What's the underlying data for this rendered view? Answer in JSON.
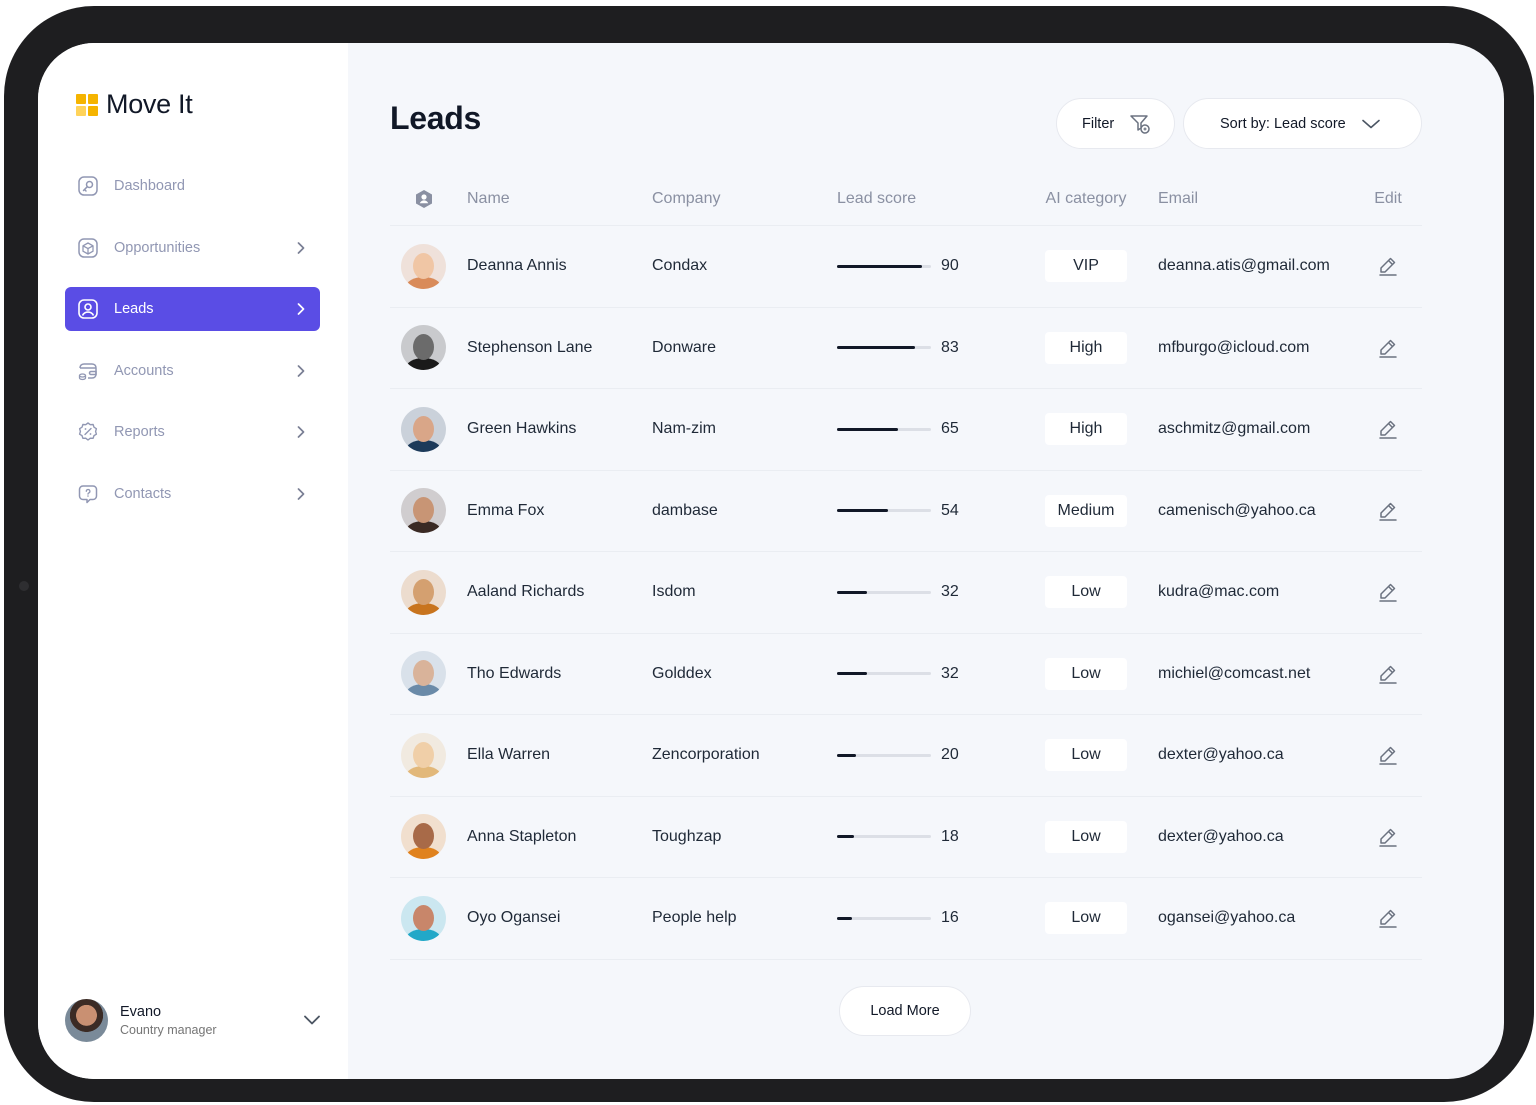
{
  "app": {
    "name": "Move It",
    "logo_colors": [
      "#f5b400",
      "#f5b400",
      "#ffd35a",
      "#f5b400"
    ]
  },
  "sidebar": {
    "items": [
      {
        "label": "Dashboard",
        "icon": "key-icon",
        "has_chevron": false,
        "active": false
      },
      {
        "label": "Opportunities",
        "icon": "cube-icon",
        "has_chevron": true,
        "active": false
      },
      {
        "label": "Leads",
        "icon": "user-square-icon",
        "has_chevron": true,
        "active": true
      },
      {
        "label": "Accounts",
        "icon": "wallet-icon",
        "has_chevron": true,
        "active": false
      },
      {
        "label": "Reports",
        "icon": "percent-badge-icon",
        "has_chevron": true,
        "active": false
      },
      {
        "label": "Contacts",
        "icon": "message-question-icon",
        "has_chevron": true,
        "active": false
      }
    ],
    "profile": {
      "name": "Evano",
      "role": "Country manager"
    }
  },
  "header": {
    "title": "Leads",
    "filter_label": "Filter",
    "sort_label": "Sort by: Lead score"
  },
  "table": {
    "columns": [
      "Name",
      "Company",
      "Lead score",
      "AI category",
      "Email",
      "Edit"
    ],
    "rows": [
      {
        "name": "Deanna Annis",
        "company": "Condax",
        "score": 90,
        "category": "VIP",
        "email": "deanna.atis@gmail.com",
        "avatar_colors": [
          "#f0c6a5",
          "#d98b5a"
        ]
      },
      {
        "name": "Stephenson Lane",
        "company": "Donware",
        "score": 83,
        "category": "High",
        "email": "mfburgo@icloud.com",
        "avatar_colors": [
          "#6b6b6b",
          "#1a1a1a"
        ]
      },
      {
        "name": "Green Hawkins",
        "company": "Nam-zim",
        "score": 65,
        "category": "High",
        "email": "aschmitz@gmail.com",
        "avatar_colors": [
          "#d9a688",
          "#1c3a5a"
        ]
      },
      {
        "name": "Emma Fox",
        "company": "dambase",
        "score": 54,
        "category": "Medium",
        "email": "camenisch@yahoo.ca",
        "avatar_colors": [
          "#c89575",
          "#3a2a24"
        ]
      },
      {
        "name": "Aaland Richards",
        "company": "Isdom",
        "score": 32,
        "category": "Low",
        "email": "kudra@mac.com",
        "avatar_colors": [
          "#d4a070",
          "#c8741e"
        ]
      },
      {
        "name": "Tho Edwards",
        "company": "Golddex",
        "score": 32,
        "category": "Low",
        "email": "michiel@comcast.net",
        "avatar_colors": [
          "#d9b39a",
          "#6a8aa8"
        ]
      },
      {
        "name": "Ella Warren",
        "company": "Zencorporation",
        "score": 20,
        "category": "Low",
        "email": "dexter@yahoo.ca",
        "avatar_colors": [
          "#f0cfa8",
          "#e2b87a"
        ]
      },
      {
        "name": "Anna Stapleton",
        "company": "Toughzap",
        "score": 18,
        "category": "Low",
        "email": "dexter@yahoo.ca",
        "avatar_colors": [
          "#a86a48",
          "#e0821e"
        ]
      },
      {
        "name": "Oyo Ogansei",
        "company": "People help",
        "score": 16,
        "category": "Low",
        "email": "ogansei@yahoo.ca",
        "avatar_colors": [
          "#c8866a",
          "#22a8c8"
        ]
      }
    ]
  },
  "load_more_label": "Load More",
  "colors": {
    "accent": "#5a4de5",
    "nav_text": "#9197b3",
    "background": "#f5f7fb"
  }
}
